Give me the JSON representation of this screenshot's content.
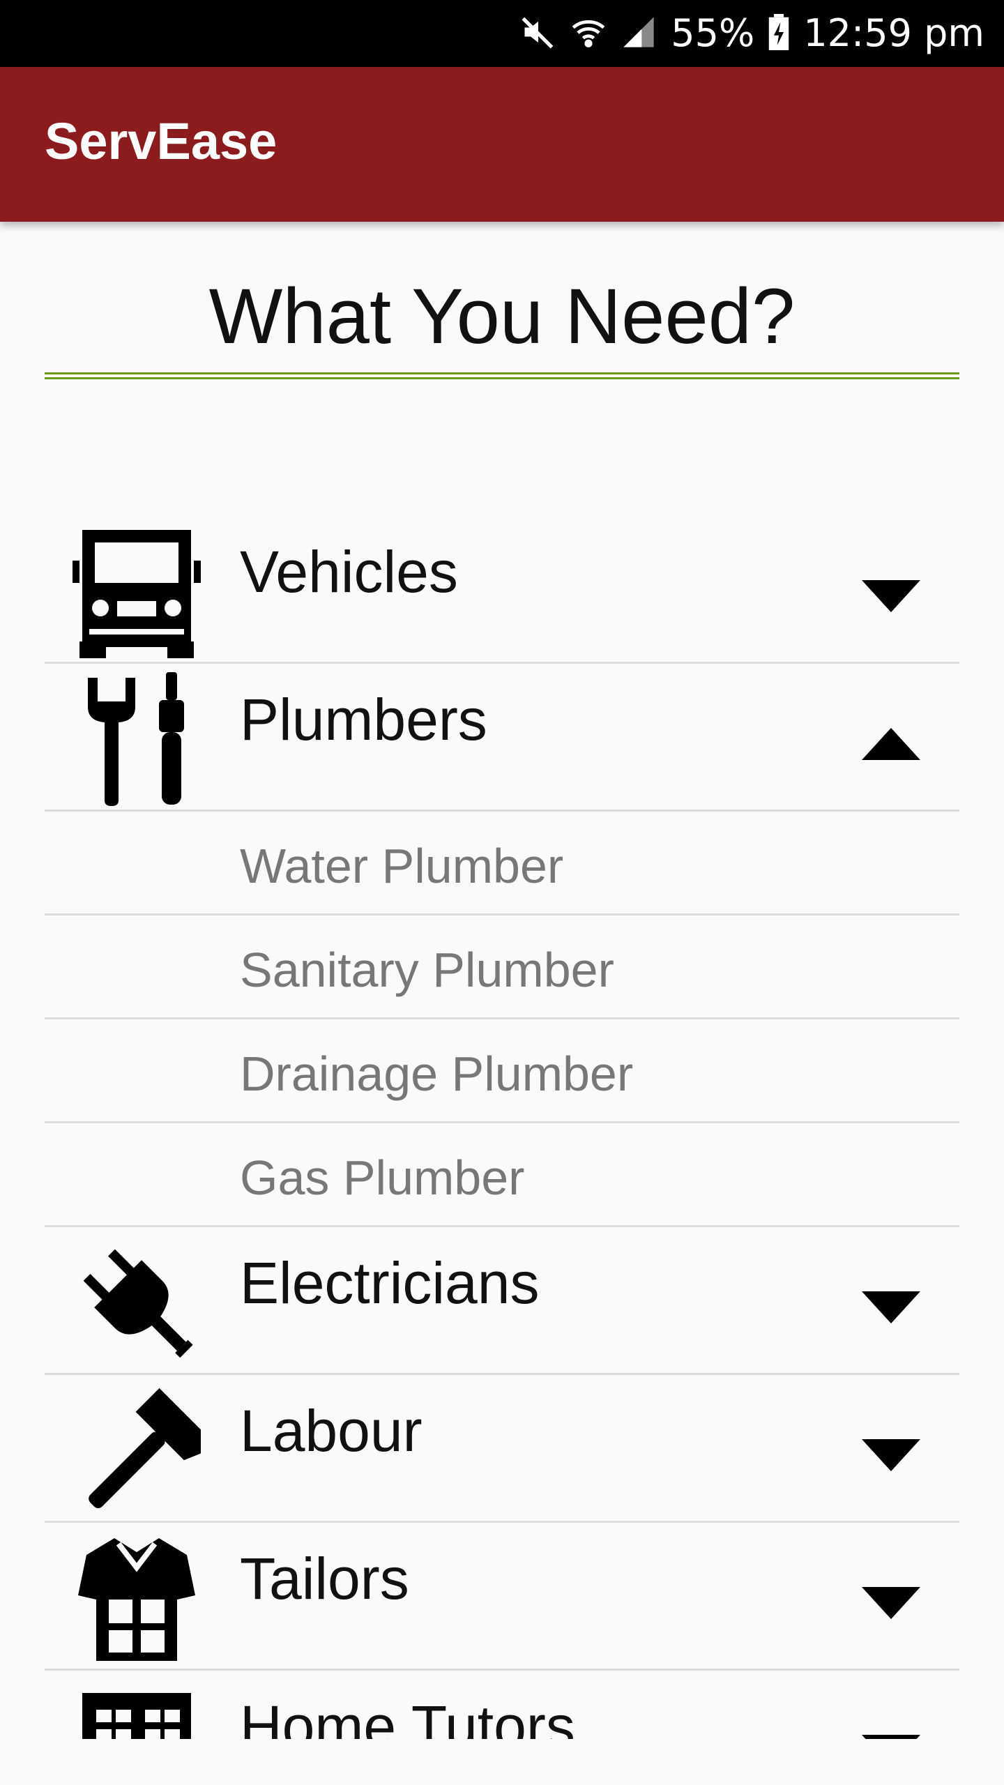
{
  "status_bar": {
    "battery": "55%",
    "time": "12:59 pm",
    "icons": [
      "mute-icon",
      "wifi-icon",
      "signal-icon",
      "battery-charging-icon"
    ]
  },
  "app_bar": {
    "title": "ServEase"
  },
  "page": {
    "title": "What You Need?"
  },
  "categories": [
    {
      "label": "Vehicles",
      "icon": "truck-icon",
      "expanded": false
    },
    {
      "label": "Plumbers",
      "icon": "tools-icon",
      "expanded": true,
      "children": [
        "Water Plumber",
        "Sanitary Plumber",
        "Drainage Plumber",
        "Gas Plumber"
      ]
    },
    {
      "label": "Electricians",
      "icon": "plug-icon",
      "expanded": false
    },
    {
      "label": "Labour",
      "icon": "hammer-icon",
      "expanded": false
    },
    {
      "label": "Tailors",
      "icon": "shirt-icon",
      "expanded": false
    },
    {
      "label": "Home Tutors",
      "icon": "building-icon",
      "expanded": false
    }
  ],
  "colors": {
    "app_bar": "#8c1b1e",
    "underline": "#6c9a1e",
    "divider": "#dcdcdc",
    "child_text": "#777777"
  }
}
